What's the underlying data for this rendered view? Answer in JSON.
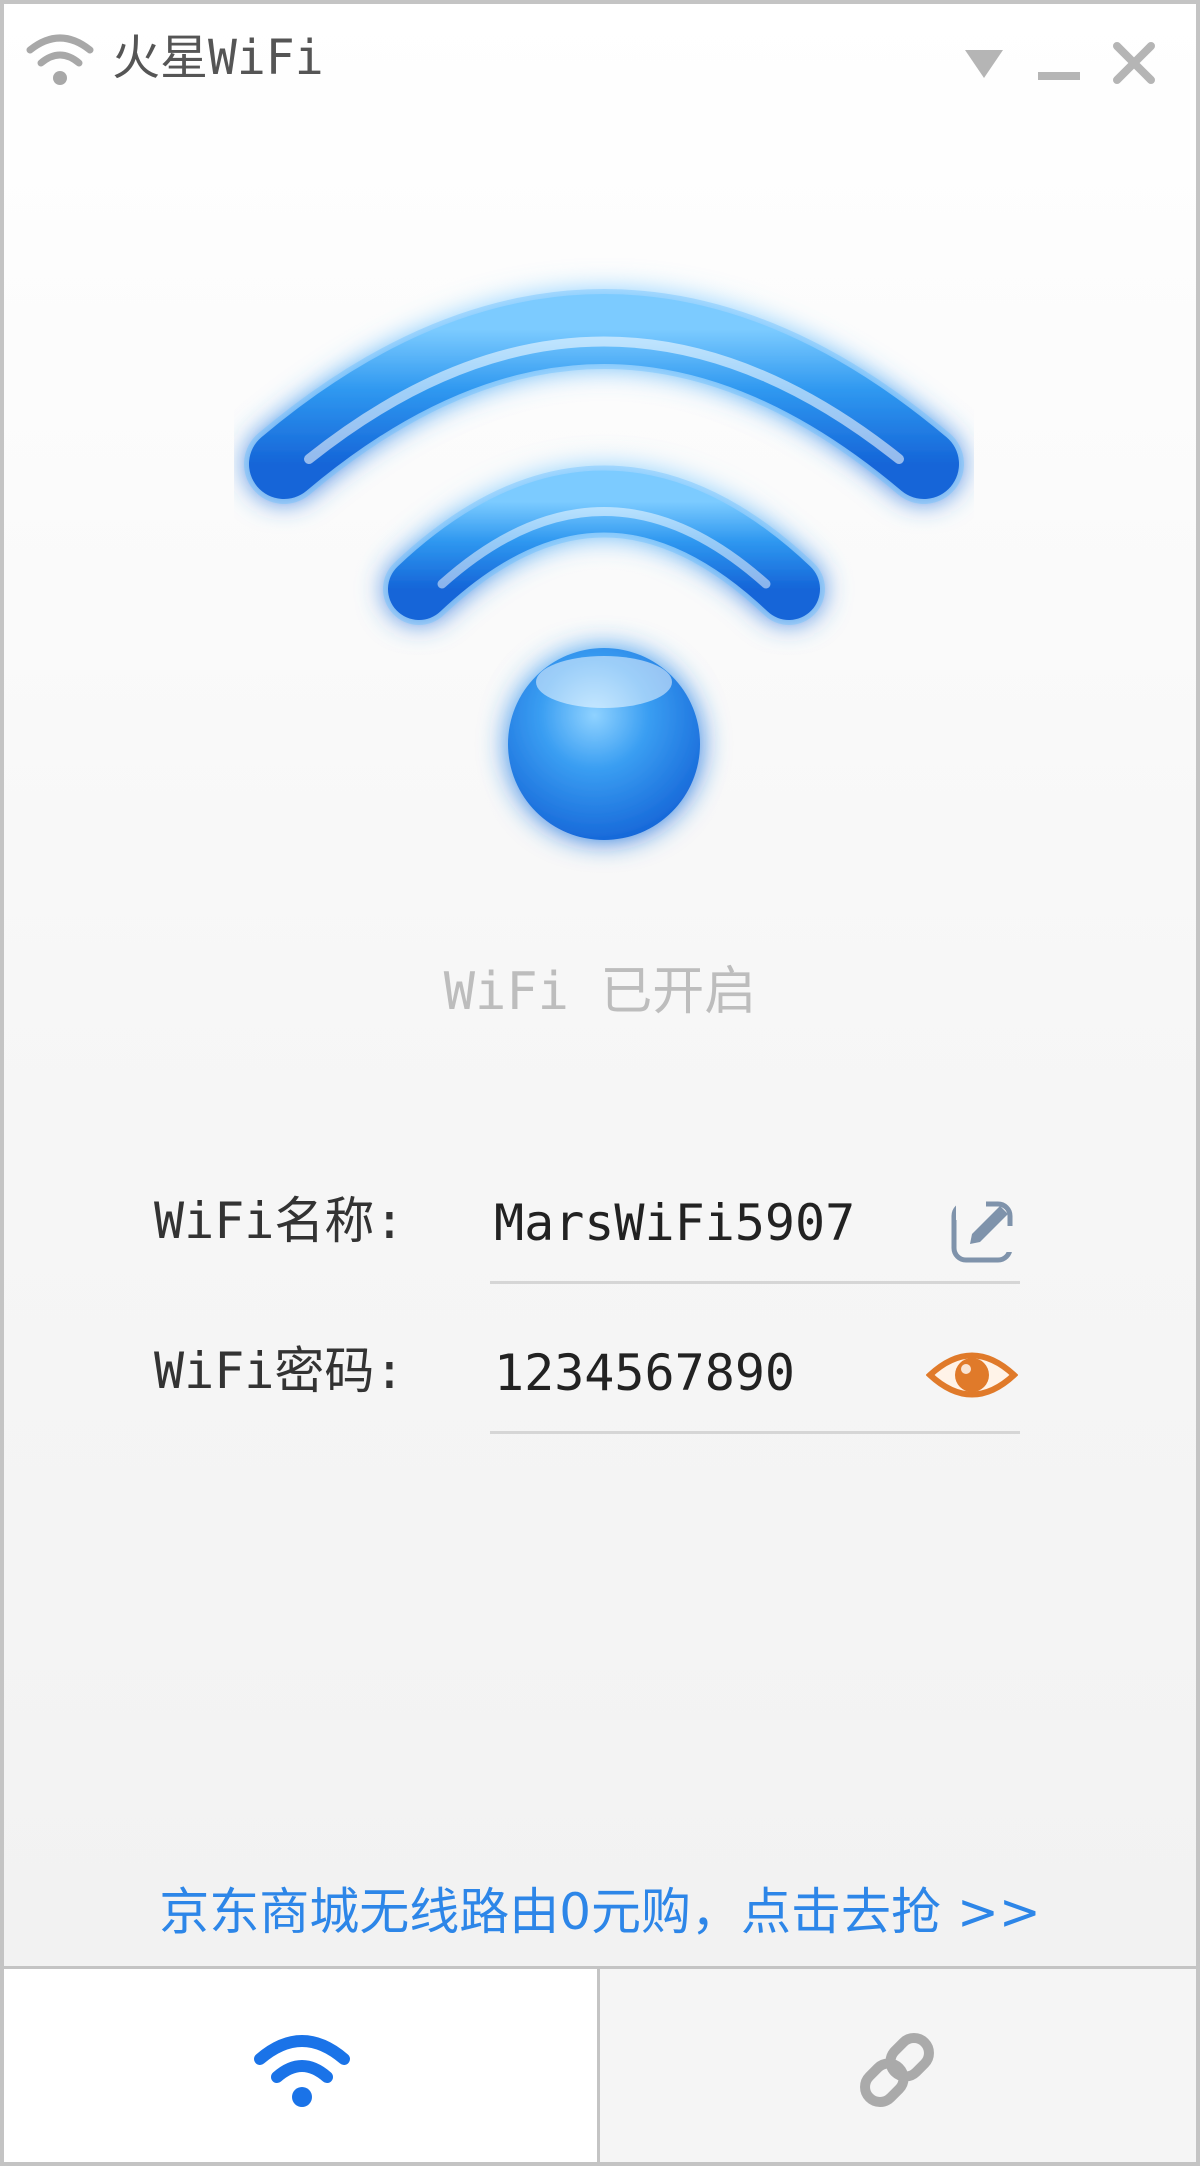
{
  "window": {
    "title": "火星WiFi"
  },
  "status": {
    "text": "WiFi 已开启"
  },
  "fields": {
    "name": {
      "label": "WiFi名称:",
      "value": "MarsWiFi5907"
    },
    "password": {
      "label": "WiFi密码:",
      "value": "1234567890"
    }
  },
  "promo": {
    "text": "京东商城无线路由0元购，点击去抢 >>"
  },
  "icons": {
    "title": "wifi-icon",
    "hero": "wifi-signal-icon",
    "edit": "edit-icon",
    "reveal": "eye-icon",
    "tab_wifi": "wifi-icon",
    "tab_link": "link-icon",
    "window_controls": [
      "chevron-down-icon",
      "minimize-icon",
      "close-icon"
    ]
  },
  "colors": {
    "accent": "#2d86e8",
    "hero_blue": "#1e7ee8",
    "eye_orange": "#e07a2a",
    "status_gray": "#bdbdbd"
  },
  "tabs": {
    "active": "wifi"
  }
}
